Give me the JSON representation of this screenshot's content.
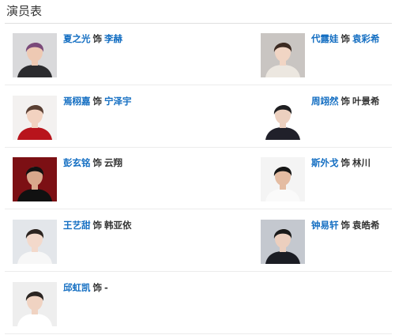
{
  "section": {
    "title": "演员表"
  },
  "cast": [
    {
      "actor": "夏之光",
      "role_word": "饰",
      "character": "李赫",
      "character_link": true,
      "photo": {
        "bg": "#d9d9db",
        "hair": "#7b4a7a",
        "skin": "#eec9b3",
        "shirt": "#2b2b2e"
      }
    },
    {
      "actor": "代露娃",
      "role_word": "饰",
      "character": "袁彩希",
      "character_link": true,
      "photo": {
        "bg": "#c9c5c2",
        "hair": "#3b2a22",
        "skin": "#f1d5c4",
        "shirt": "#ece7e0"
      }
    },
    {
      "actor": "焉栩嘉",
      "role_word": "饰",
      "character": "宁泽宇",
      "character_link": true,
      "photo": {
        "bg": "#f3f1f0",
        "hair": "#5a4034",
        "skin": "#f2d2c0",
        "shirt": "#b8141c"
      }
    },
    {
      "actor": "周翊然",
      "role_word": "饰",
      "character": "叶景希",
      "character_link": false,
      "photo": {
        "bg": "#ffffff",
        "hair": "#1f1f22",
        "skin": "#ecd0bf",
        "shirt": "#20202a"
      }
    },
    {
      "actor": "彭玄铭",
      "role_word": "饰",
      "character": "云翔",
      "character_link": false,
      "photo": {
        "bg": "#7c1014",
        "hair": "#121212",
        "skin": "#d9a88c",
        "shirt": "#111111"
      }
    },
    {
      "actor": "斯外戈",
      "role_word": "饰",
      "character": "林川",
      "character_link": false,
      "photo": {
        "bg": "#f4f4f4",
        "hair": "#151515",
        "skin": "#e4bca2",
        "shirt": "#fafafa"
      }
    },
    {
      "actor": "王艺甜",
      "role_word": "饰",
      "character": "韩亚依",
      "character_link": false,
      "photo": {
        "bg": "#e3e6ea",
        "hair": "#2c2521",
        "skin": "#f3d9cb",
        "shirt": "#f7f7f7"
      }
    },
    {
      "actor": "钟易轩",
      "role_word": "饰",
      "character": "袁皓希",
      "character_link": false,
      "photo": {
        "bg": "#c4c8cf",
        "hair": "#1a1a1a",
        "skin": "#eccfbe",
        "shirt": "#1b1d24"
      }
    },
    {
      "actor": "邱虹凯",
      "role_word": "饰",
      "character": "-",
      "character_link": false,
      "photo": {
        "bg": "#eeeeee",
        "hair": "#2b2522",
        "skin": "#f0d3c2",
        "shirt": "#ffffff"
      }
    }
  ]
}
